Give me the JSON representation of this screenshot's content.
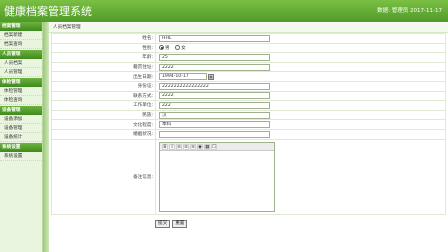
{
  "header": {
    "title": "健康档案管理系统",
    "user_info": "数据: 管理员  2017-11-17"
  },
  "sidebar": [
    {
      "title": "档案管理",
      "items": [
        "档案新建",
        "档案查询"
      ]
    },
    {
      "title": "人员管理",
      "items": [
        "人员档案",
        "人员管理"
      ]
    },
    {
      "title": "体检管理",
      "items": [
        "体检管理",
        "体检查询"
      ]
    },
    {
      "title": "设备管理",
      "items": [
        "设备添加",
        "设备管理",
        "设备统计"
      ]
    },
    {
      "title": "系统设置",
      "items": [
        "系统设置"
      ]
    }
  ],
  "breadcrumb": "人员档案管理",
  "form": {
    "name": {
      "label": "姓名:",
      "value": "HHL"
    },
    "gender": {
      "label": "性别:",
      "options": [
        "男",
        "女"
      ],
      "selected": "男"
    },
    "age": {
      "label": "年龄:",
      "value": "25"
    },
    "birthplace": {
      "label": "籍贯住址:",
      "value": "2222"
    },
    "birthdate": {
      "label": "出生日期:",
      "value": "1994-10-17"
    },
    "id_card": {
      "label": "身份证:",
      "value": "2222222222222222"
    },
    "contact": {
      "label": "联系方式:",
      "value": "2222"
    },
    "work_unit": {
      "label": "工作单位:",
      "value": "222"
    },
    "ethnicity": {
      "label": "民族:",
      "value": "汉"
    },
    "education": {
      "label": "文化程度:",
      "value": "本科"
    },
    "marital": {
      "label": "婚姻状况:",
      "value": ""
    },
    "notes": {
      "label": "备注信息:",
      "toolbar": [
        "B",
        "I",
        "≡",
        "≡",
        "≡",
        "◉",
        "▦",
        "☐"
      ]
    }
  },
  "buttons": {
    "submit": "提交",
    "reset": "重置"
  }
}
